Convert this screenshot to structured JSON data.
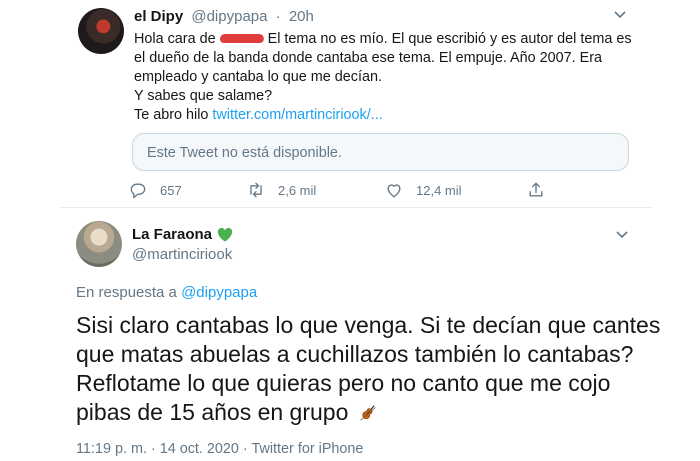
{
  "tweet1": {
    "author_name": "el Dipy",
    "author_handle": "@dipypapa",
    "separator": "·",
    "time": "20h",
    "lines": {
      "l1_before": "Hola cara de",
      "l1_after": " El tema no es mío.  El que escribió y es autor del tema es",
      "l2": "el dueño de la banda donde cantaba ese tema. El empuje. Año 2007. Era",
      "l3": "empleado y cantaba lo que me decían.",
      "l4": "Y sabes que salame?",
      "l5_before": "Te abro hilo ",
      "l5_link": "twitter.com/martinciriook/..."
    },
    "quoted_unavailable": "Este Tweet no está disponible.",
    "replies": "657",
    "retweets": "2,6 mil",
    "likes": "12,4 mil"
  },
  "tweet2": {
    "author_name": "La Faraona",
    "author_handle": "@martinciriook",
    "reply_prefix": "En respuesta a ",
    "reply_handle": "@dipypapa",
    "body": [
      "Sisi claro cantabas lo que venga. Si te decían que cantes",
      "que matas abuelas a cuchillazos también lo cantabas?",
      "Reflotame lo que quieras pero no canto que me cojo",
      "pibas de 15 años en grupo"
    ],
    "footer": "11:19 p. m. · 14 oct. 2020 · Twitter for iPhone"
  },
  "colors": {
    "link": "#1da1f2",
    "muted": "#657786",
    "text": "#14171a",
    "heart": "#4caf50",
    "redaction": "#e03c3c"
  }
}
